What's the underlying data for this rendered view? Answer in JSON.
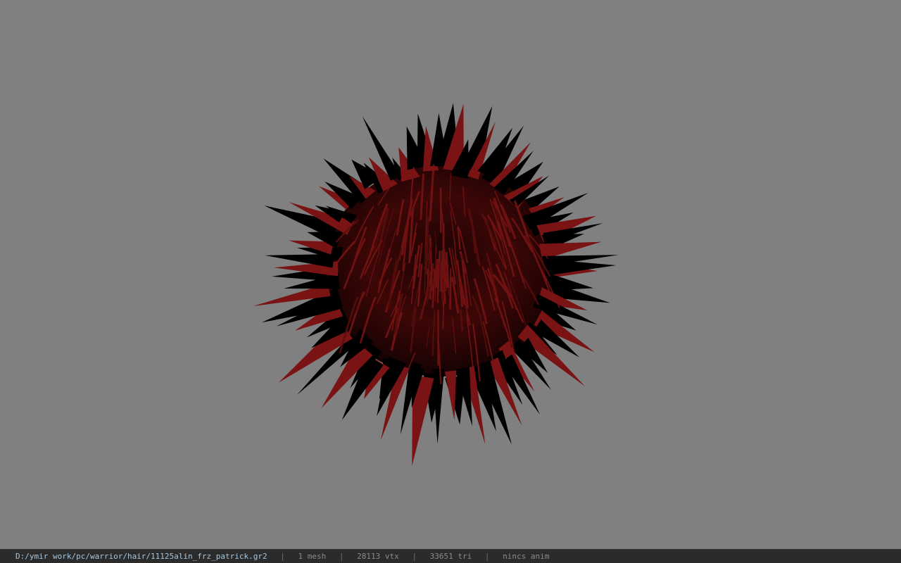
{
  "viewport": {
    "background_color": "#808080",
    "model": {
      "icon": "hair-mesh-icon",
      "hair_color": "#7a1414",
      "shadow_color": "#000000"
    }
  },
  "status_bar": {
    "file_path": "D:/ymir work/pc/warrior/hair/11125alin_frz_patrick.gr2",
    "separator": "|",
    "mesh_count": "1 mesh",
    "vertex_count": "28113 vtx",
    "triangle_count": "33651 tri",
    "anim_status": "nincs anim"
  }
}
